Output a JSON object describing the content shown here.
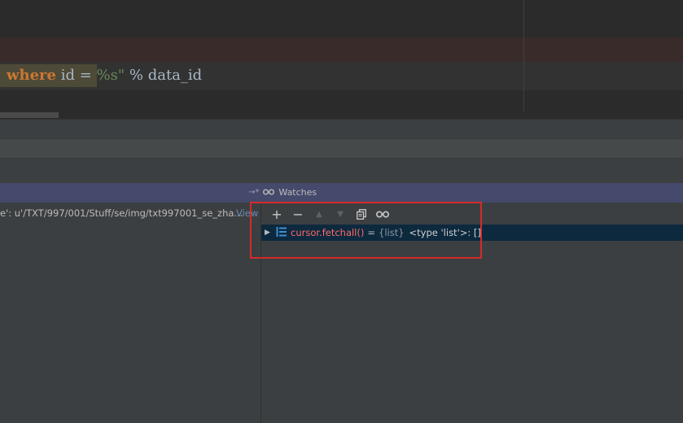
{
  "editor": {
    "code_keyword": "where",
    "code_mid": " id = ",
    "code_fmt": "%s\"",
    "code_tail": " % data_id"
  },
  "debug": {
    "watches_title": "Watches",
    "variable_text": "e': u'/TXT/997/001/Stuff/se/img/txt997001_se_zha...",
    "variable_view_link": "View",
    "toolbar": {
      "add": "+",
      "remove": "−",
      "up": "▲",
      "down": "▼",
      "copy": "copy-icon",
      "watch": "glasses-icon"
    },
    "watch_item": {
      "expression": "cursor.fetchall()",
      "equals": "=",
      "type": "{list}",
      "value": "<type 'list'>: []"
    }
  },
  "colors": {
    "accent_header": "#45496b",
    "selection": "#0d293e",
    "annotation_box": "#d62a2a"
  }
}
